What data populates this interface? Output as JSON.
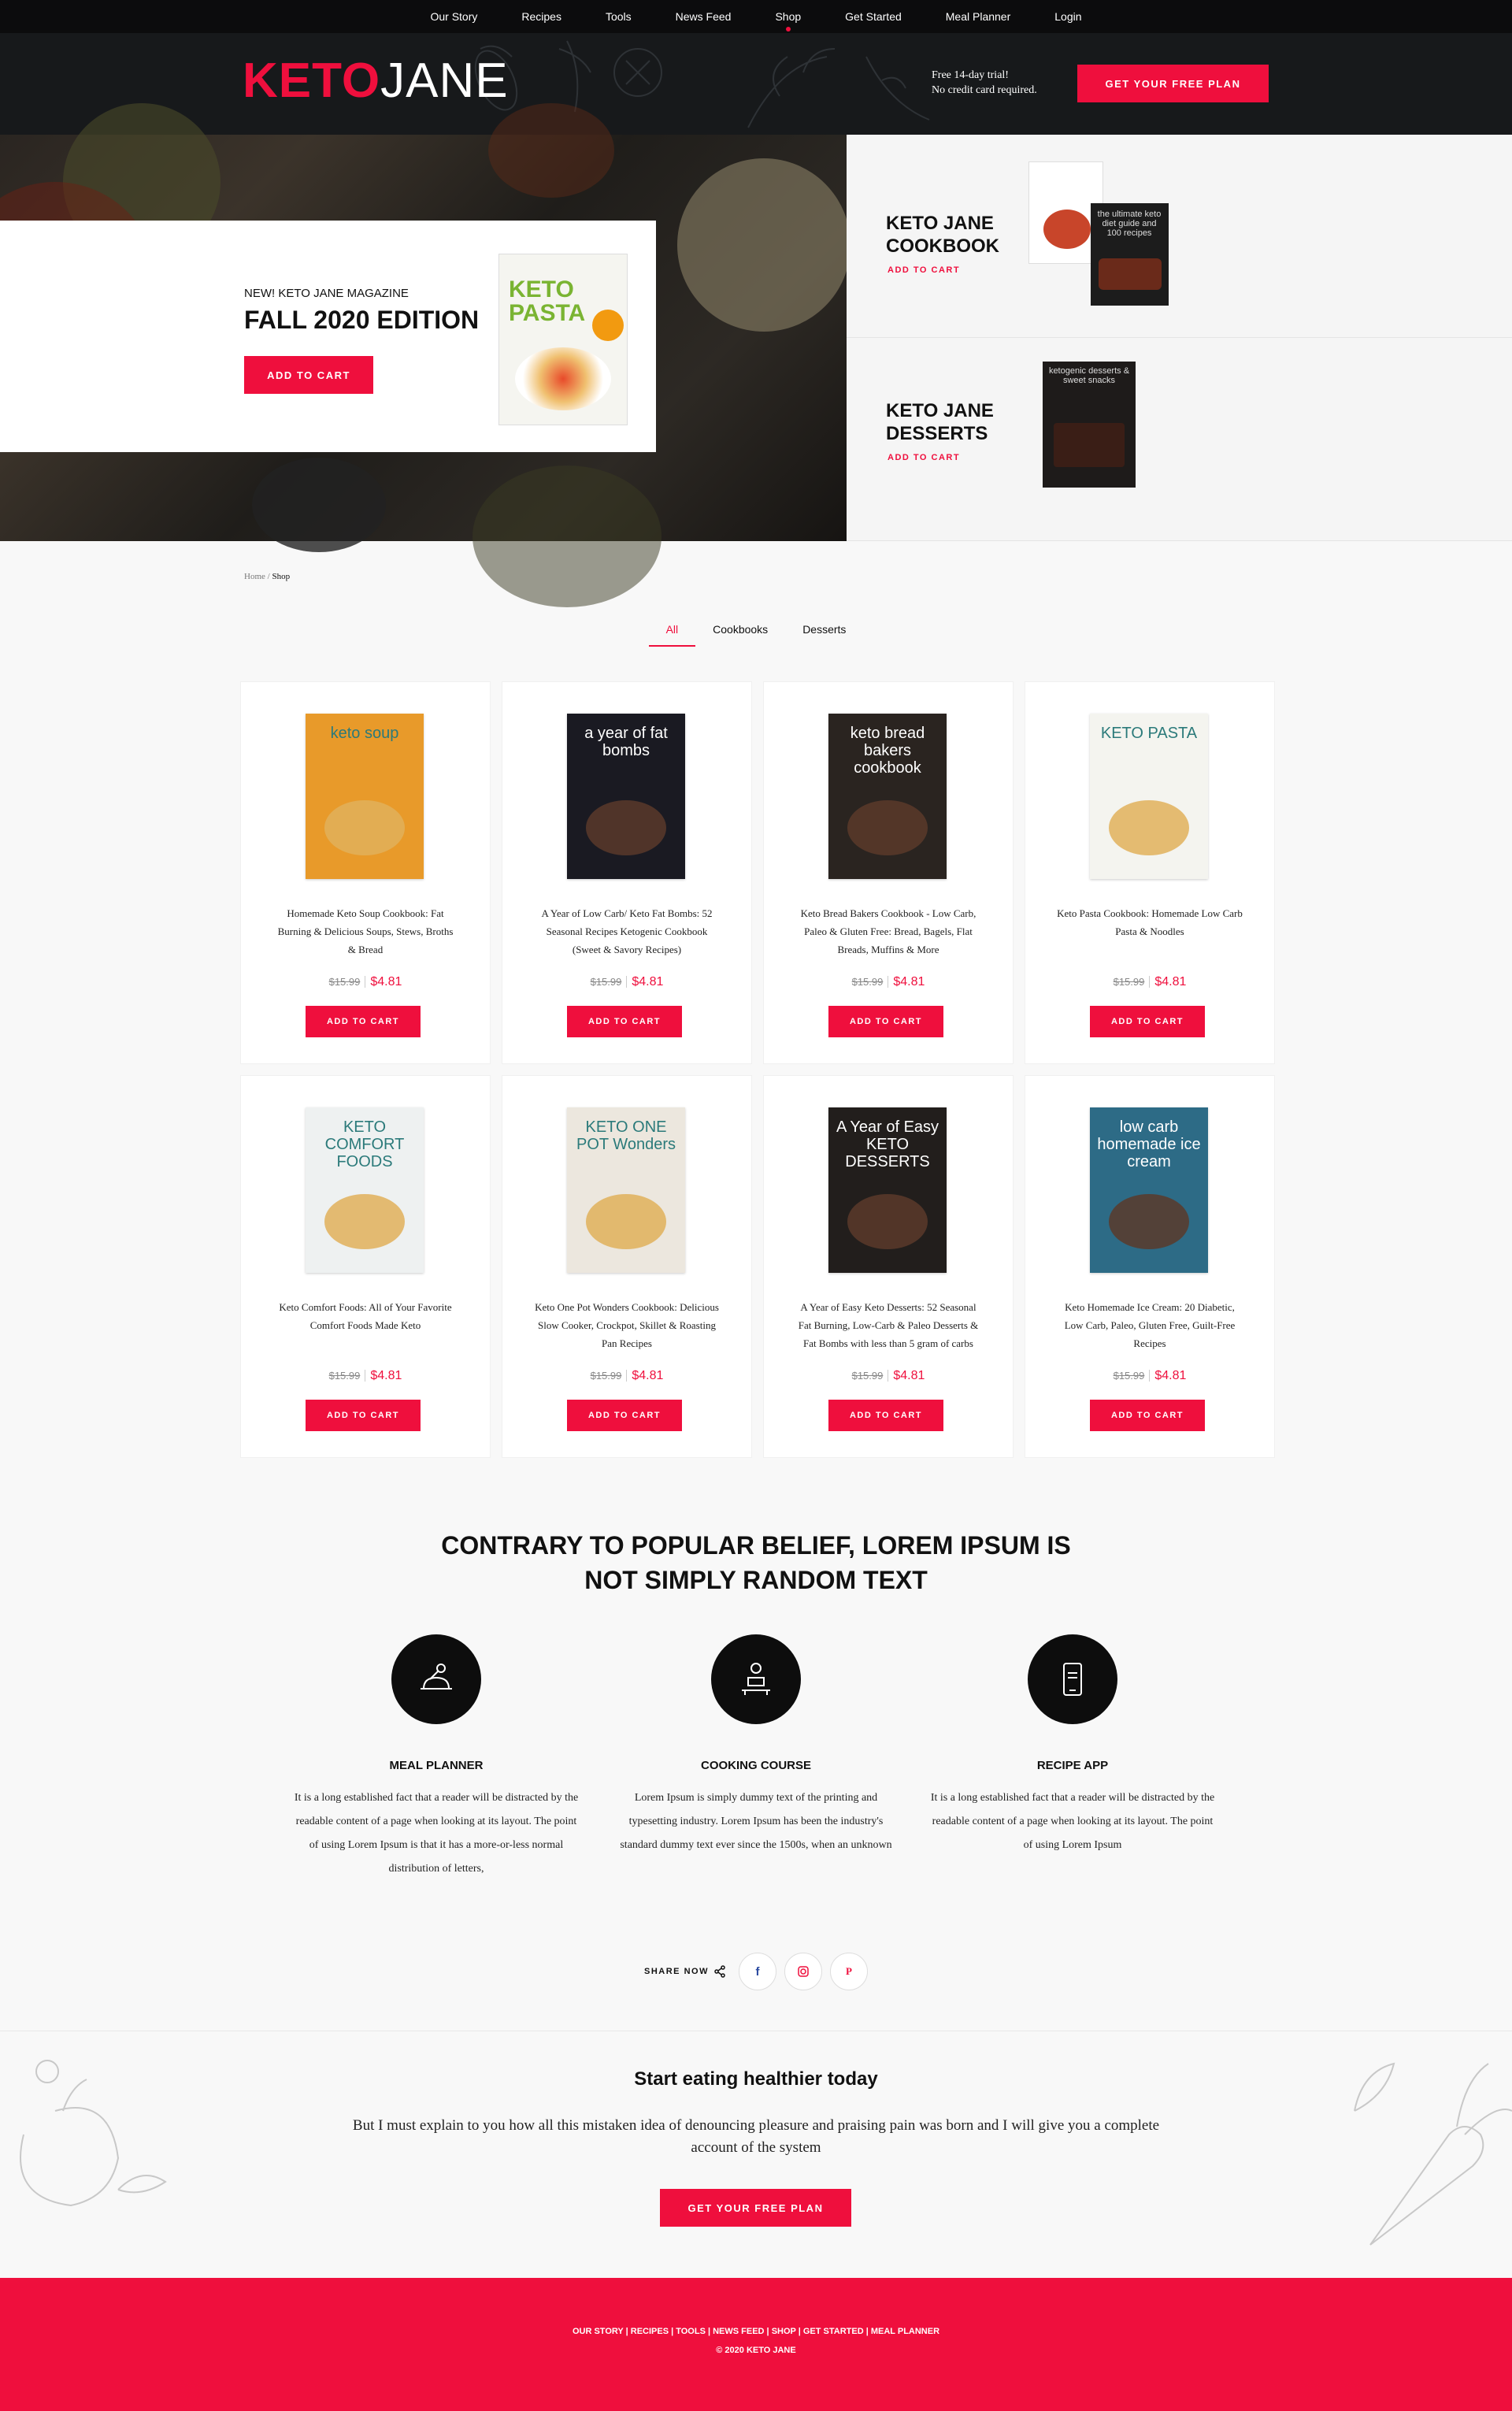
{
  "nav": [
    "Our Story",
    "Recipes",
    "Tools",
    "News Feed",
    "Shop",
    "Get Started",
    "Meal Planner",
    "Login"
  ],
  "nav_active": "Shop",
  "header": {
    "logo_keto": "KETO",
    "logo_jane": "JANE",
    "trial_line1": "Free 14-day trial!",
    "trial_line2": "No credit card required.",
    "cta": "GET YOUR FREE PLAN"
  },
  "hero": {
    "tag": "NEW! KETO JANE MAGAZINE",
    "title": "FALL 2020 EDITION",
    "button": "ADD TO CART",
    "cover_title": "KETO PASTA",
    "side": [
      {
        "title_1": "KETO JANE",
        "title_2": "COOKBOOK",
        "link": "ADD TO CART"
      },
      {
        "title_1": "KETO JANE",
        "title_2": "DESSERTS",
        "link": "ADD TO CART"
      }
    ]
  },
  "breadcrumb": {
    "home": "Home",
    "sep": "/",
    "current": "Shop"
  },
  "tabs": [
    "All",
    "Cookbooks",
    "Desserts"
  ],
  "products": [
    {
      "title": "Homemade Keto Soup Cookbook: Fat Burning & Delicious Soups, Stews, Broths & Bread",
      "old": "$15.99",
      "new": "$4.81",
      "cover": "keto soup",
      "bg": "#e89a2a"
    },
    {
      "title": "A Year of Low Carb/ Keto Fat Bombs: 52 Seasonal Recipes Ketogenic Cookbook (Sweet & Savory Recipes)",
      "old": "$15.99",
      "new": "$4.81",
      "cover": "a year of fat bombs",
      "bg": "#1a1a22"
    },
    {
      "title": "Keto Bread Bakers Cookbook - Low Carb, Paleo & Gluten Free: Bread, Bagels, Flat Breads, Muffins & More",
      "old": "$15.99",
      "new": "$4.81",
      "cover": "keto bread bakers cookbook",
      "bg": "#2a2420"
    },
    {
      "title": "Keto Pasta Cookbook: Homemade Low Carb Pasta & Noodles",
      "old": "$15.99",
      "new": "$4.81",
      "cover": "KETO PASTA",
      "bg": "#f4f4ef"
    },
    {
      "title": "Keto Comfort Foods: All of Your Favorite Comfort Foods Made Keto",
      "old": "$15.99",
      "new": "$4.81",
      "cover": "KETO COMFORT FOODS",
      "bg": "#eef1f1"
    },
    {
      "title": "Keto One Pot Wonders Cookbook: Delicious Slow Cooker, Crockpot, Skillet & Roasting Pan Recipes",
      "old": "$15.99",
      "new": "$4.81",
      "cover": "KETO ONE POT Wonders",
      "bg": "#ece7de"
    },
    {
      "title": "A Year of Easy Keto Desserts: 52 Seasonal Fat Burning, Low-Carb & Paleo Desserts & Fat Bombs with less than 5 gram of carbs",
      "old": "$15.99",
      "new": "$4.81",
      "cover": "A Year of Easy KETO DESSERTS",
      "bg": "#221e1c"
    },
    {
      "title": "Keto Homemade Ice Cream: 20 Diabetic, Low Carb, Paleo, Gluten Free, Guilt-Free Recipes",
      "old": "$15.99",
      "new": "$4.81",
      "cover": "low carb homemade ice cream",
      "bg": "#2d6b86"
    }
  ],
  "add_to_cart": "ADD TO CART",
  "section": {
    "title_1": "CONTRARY TO POPULAR BELIEF, LOREM IPSUM IS",
    "title_2": "NOT SIMPLY RANDOM TEXT"
  },
  "features": [
    {
      "title": "MEAL PLANNER",
      "icon": "meal-icon",
      "text": "It is a long established fact that a reader will be distracted by the readable content of a page when looking at its layout. The point of using Lorem Ipsum is that it has a more-or-less normal distribution of letters,"
    },
    {
      "title": "COOKING COURSE",
      "icon": "chef-icon",
      "text": "Lorem Ipsum is simply dummy text of the printing and typesetting industry. Lorem Ipsum has been the industry's standard dummy text ever since the 1500s, when an unknown"
    },
    {
      "title": "RECIPE APP",
      "icon": "phone-icon",
      "text": "It is a long established fact that a reader will be distracted by the readable content of a page when looking at its layout. The point of using Lorem Ipsum"
    }
  ],
  "share": {
    "label": "SHARE NOW",
    "facebook": "f",
    "pinterest": "P"
  },
  "cta": {
    "title": "Start eating healthier today",
    "text": "But I must explain to you how all this mistaken idea of denouncing pleasure and praising pain was born and I will give you a complete account of the system",
    "button": "GET YOUR FREE PLAN"
  },
  "footer": {
    "links": "OUR STORY | RECIPES | TOOLS | NEWS FEED | SHOP | GET STARTED | MEAL PLANNER",
    "copy": "© 2020 KETO JANE"
  },
  "colors": {
    "accent": "#ef0f3d",
    "dark": "#17191b"
  }
}
